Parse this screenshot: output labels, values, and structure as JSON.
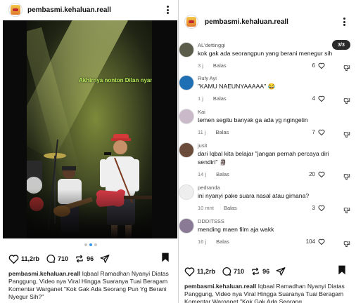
{
  "post": {
    "username": "pembasmi.kehaluan.reall",
    "video_overlay_text": "Akhirnya nonton Dilan nyanyi",
    "likes": "11,2rb",
    "comments": "710",
    "reposts": "96",
    "caption_username": "pembasmi.kehaluan.reall",
    "caption_text": "Iqbaal Ramadhan Nyanyi Diatas Panggung, Video nya Viral Hingga Suaranya Tuai Beragam Komentar Warganet \"Kok Gak Ada Seorang Pun Yg Berani Nyegur Sih?\""
  },
  "comments_panel": {
    "username": "pembasmi.kehaluan.reall",
    "page_indicator": "3/3",
    "comments": [
      {
        "user": "AL'dettinggi",
        "text": "kok gak ada seorangpun yang berani menegur sih",
        "time": "3 j",
        "reply": "Balas",
        "likes": "6",
        "avatar_color": "#5c5c4a"
      },
      {
        "user": "Ruly Ayi",
        "text": "\"KAMU NAEUNYAAAAA\" 😂",
        "time": "1 j",
        "reply": "Balas",
        "likes": "4",
        "avatar_color": "#1f6fb5"
      },
      {
        "user": "Kai",
        "text": "temen segitu banyak ga ada yg ngingetin",
        "time": "11 j",
        "reply": "Balas",
        "likes": "7",
        "avatar_color": "#c9b9c9"
      },
      {
        "user": "jusit",
        "text": "dari Iqbal kita belajar \"jangan pernah percaya diri sendiri\" 🗿",
        "time": "14 j",
        "reply": "Balas",
        "likes": "20",
        "avatar_color": "#6b4c3b"
      },
      {
        "user": "pedranda",
        "text": "ini nyanyi pake suara nasal atau gimana?",
        "time": "10 mnt",
        "reply": "Balas",
        "likes": "3",
        "avatar_color": "#eeeeee"
      },
      {
        "user": "DDDITSSS",
        "text": "mending maen film aja wakk",
        "time": "16 j",
        "reply": "Balas",
        "likes": "104",
        "avatar_color": "#8a7a96"
      }
    ],
    "likes": "11,2rb",
    "comments_count": "710",
    "reposts": "96",
    "caption_username": "pembasmi.kehaluan.reall",
    "caption_text": "Iqbaal Ramadhan Nyanyi Diatas Panggung, Video nya Viral Hingga Suaranya Tuai Beragam Komentar Warganet \"Kok Gak Ada Seorang"
  }
}
